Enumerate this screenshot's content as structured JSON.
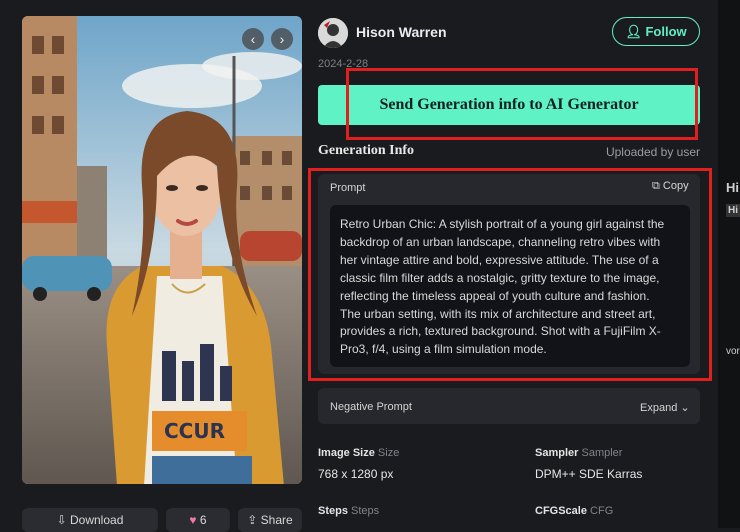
{
  "author": {
    "name": "Hison Warren",
    "follow_label": "Follow",
    "date": "2024-2-28"
  },
  "send_button_label": "Send Generation info to AI Generator",
  "generation_info": {
    "title": "Generation Info",
    "uploaded_by": "Uploaded by user"
  },
  "prompt": {
    "label": "Prompt",
    "copy_label": "Copy",
    "lines": [
      "Retro Urban Chic: A stylish portrait of a young girl against the",
      "backdrop of an urban landscape, channeling retro vibes with",
      "her vintage attire and bold, expressive attitude. The use of a",
      "classic film filter adds a nostalgic, gritty texture to the image,",
      "reflecting the timeless appeal of youth culture and fashion.",
      "The urban setting, with its mix of architecture and street art,",
      "provides a rich, textured background. Shot with a FujiFilm X-",
      "Pro3, f/4, using a film simulation mode."
    ]
  },
  "negative_prompt": {
    "label": "Negative Prompt",
    "expand_label": "Expand"
  },
  "meta": {
    "image_size": {
      "label": "Image Size",
      "sub": "Size",
      "value": "768 x 1280 px"
    },
    "sampler": {
      "label": "Sampler",
      "sub": "Sampler",
      "value": "DPM++ SDE Karras"
    },
    "steps": {
      "label": "Steps",
      "sub": "Steps"
    },
    "cfg_scale": {
      "label": "CFGScale",
      "sub": "CFG"
    }
  },
  "image_actions": {
    "download_label": "Download",
    "like_count": "6",
    "share_label": "Share"
  },
  "right_strip": {
    "letters_1": "Hi",
    "letters_2": "Hi",
    "letters_3": "vor"
  },
  "colors": {
    "accent": "#5ef2c5",
    "highlight_box": "#e0201f",
    "panel": "#26282d",
    "background": "#1a1b1e"
  }
}
